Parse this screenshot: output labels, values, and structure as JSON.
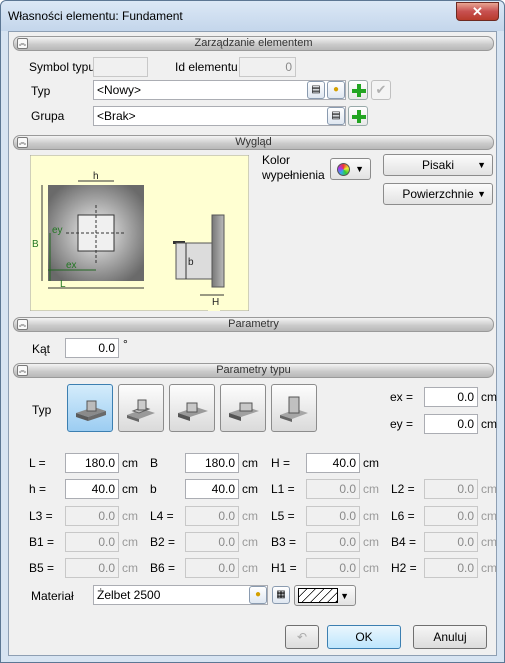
{
  "window": {
    "title": "Własności elementu: Fundament",
    "close_glyph": "✕"
  },
  "sections": {
    "management": "Zarządzanie elementem",
    "appearance": "Wygląd",
    "parameters": "Parametry",
    "type_parameters": "Parametry typu"
  },
  "management": {
    "symbol_label": "Symbol typu",
    "symbol_value": "",
    "id_label": "Id elementu",
    "id_value": "0",
    "type_label": "Typ",
    "type_value": "<Nowy>",
    "group_label": "Grupa",
    "group_value": "<Brak>"
  },
  "appearance": {
    "fill_color_label_1": "Kolor",
    "fill_color_label_2": "wypełnienia",
    "pens_button": "Pisaki",
    "surfaces_button": "Powierzchnie",
    "diagram": {
      "h": "h",
      "b": "b",
      "ey": "ey",
      "ex": "ex",
      "B": "B",
      "L": "L",
      "H": "H"
    }
  },
  "parameters": {
    "angle_label": "Kąt",
    "angle_value": "0.0",
    "angle_unit": "°"
  },
  "type_params": {
    "type_label": "Typ",
    "ex_label": "ex =",
    "ex_value": "0.0",
    "ey_label": "ey =",
    "ey_value": "0.0",
    "unit": "cm",
    "rows": [
      [
        {
          "label": "L =",
          "value": "180.0",
          "enabled": true
        },
        {
          "label": "B",
          "value": "180.0",
          "enabled": true
        },
        {
          "label": "H =",
          "value": "40.0",
          "enabled": true
        }
      ],
      [
        {
          "label": "h =",
          "value": "40.0",
          "enabled": true
        },
        {
          "label": "b",
          "value": "40.0",
          "enabled": true
        },
        {
          "label": "L1 =",
          "value": "0.0",
          "enabled": false
        },
        {
          "label": "L2 =",
          "value": "0.0",
          "enabled": false
        }
      ],
      [
        {
          "label": "L3 =",
          "value": "0.0",
          "enabled": false
        },
        {
          "label": "L4 =",
          "value": "0.0",
          "enabled": false
        },
        {
          "label": "L5 =",
          "value": "0.0",
          "enabled": false
        },
        {
          "label": "L6 =",
          "value": "0.0",
          "enabled": false
        }
      ],
      [
        {
          "label": "B1 =",
          "value": "0.0",
          "enabled": false
        },
        {
          "label": "B2 =",
          "value": "0.0",
          "enabled": false
        },
        {
          "label": "B3 =",
          "value": "0.0",
          "enabled": false
        },
        {
          "label": "B4 =",
          "value": "0.0",
          "enabled": false
        }
      ],
      [
        {
          "label": "B5 =",
          "value": "0.0",
          "enabled": false
        },
        {
          "label": "B6 =",
          "value": "0.0",
          "enabled": false
        },
        {
          "label": "H1 =",
          "value": "0.0",
          "enabled": false
        },
        {
          "label": "H2 =",
          "value": "0.0",
          "enabled": false
        }
      ]
    ],
    "material_label": "Materiał",
    "material_value": "Żelbet 2500"
  },
  "footer": {
    "ok": "OK",
    "cancel": "Anuluj"
  },
  "colors": {
    "accent": "#3c7fb1",
    "plus_green": "#22a522",
    "diagram_bg": "#ffffd2"
  }
}
